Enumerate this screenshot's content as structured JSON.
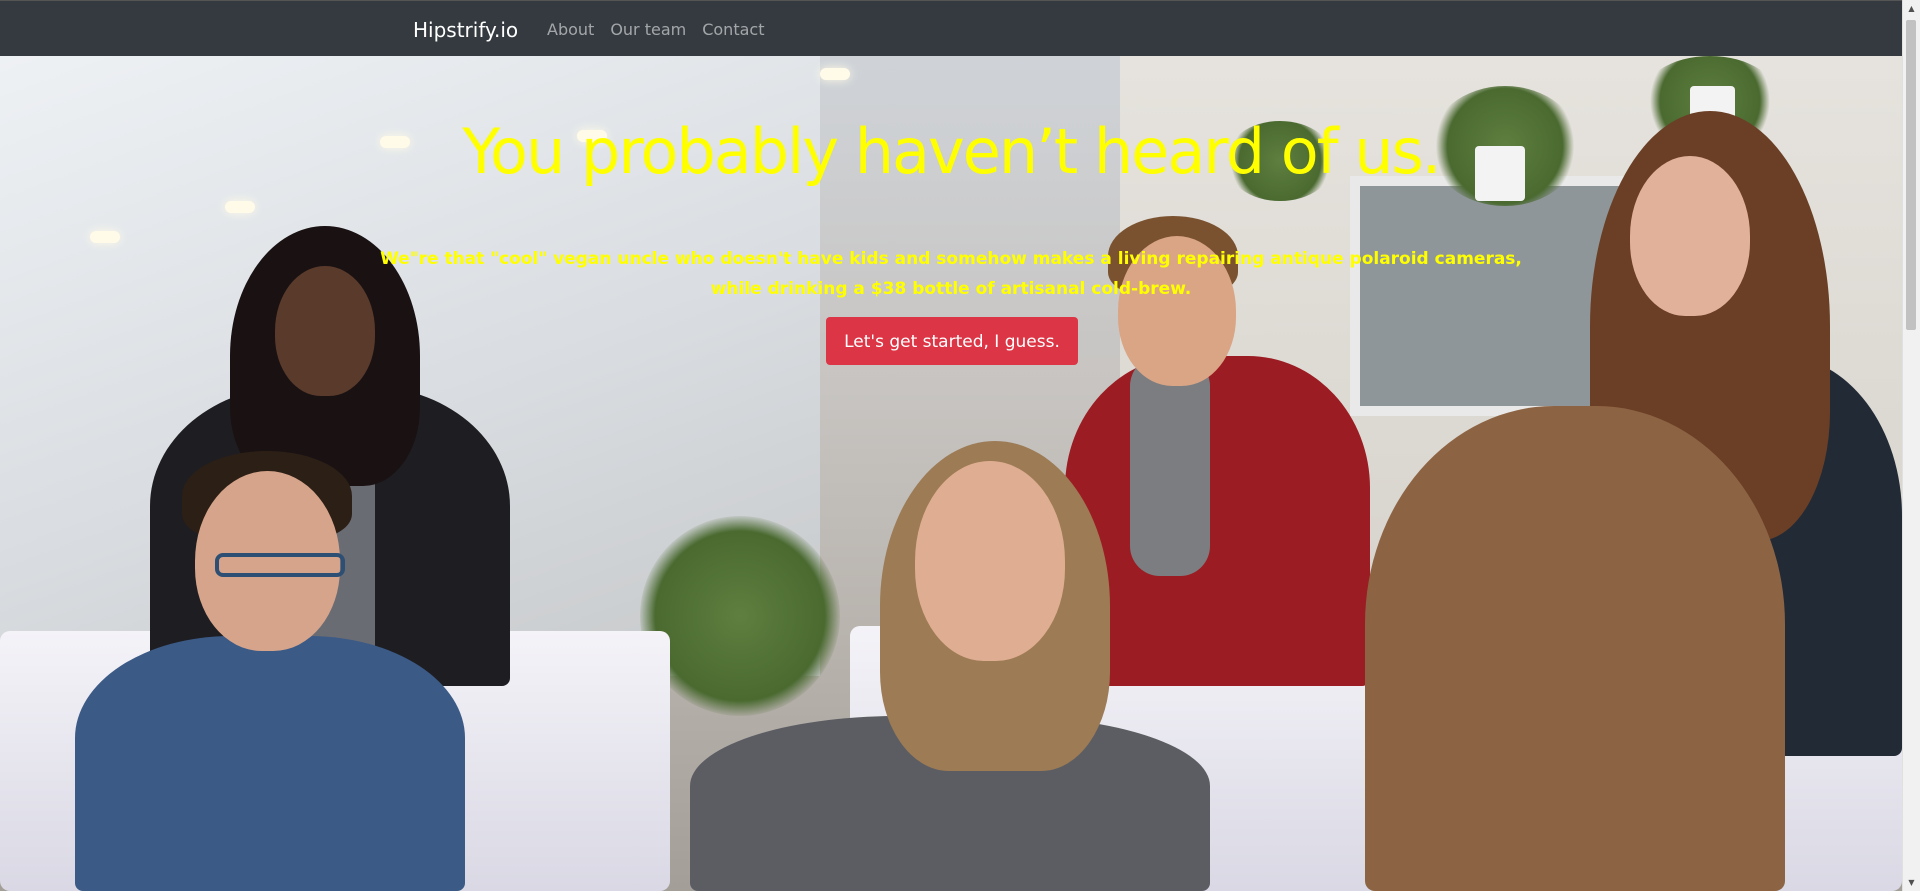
{
  "navbar": {
    "brand": "Hipstrify.io",
    "links": [
      "About",
      "Our team",
      "Contact"
    ]
  },
  "hero": {
    "title": "You probably haven’t heard of us.",
    "lead": "We\"re that \"cool\" vegan uncle who doesn't have kids and somehow makes a living repairing antique polaroid cameras, while drinking a $38 bottle of artisanal cold-brew.",
    "button_label": "Let's get started, I guess.",
    "background_image": "office team meeting photo"
  },
  "colors": {
    "navbar_bg": "#343a40",
    "hero_text": "#ffff00",
    "button_bg": "#dc3545",
    "button_text": "#ffffff"
  },
  "icons": {
    "scroll_up": "scroll-up-arrow-icon",
    "scroll_down": "scroll-down-arrow-icon"
  }
}
